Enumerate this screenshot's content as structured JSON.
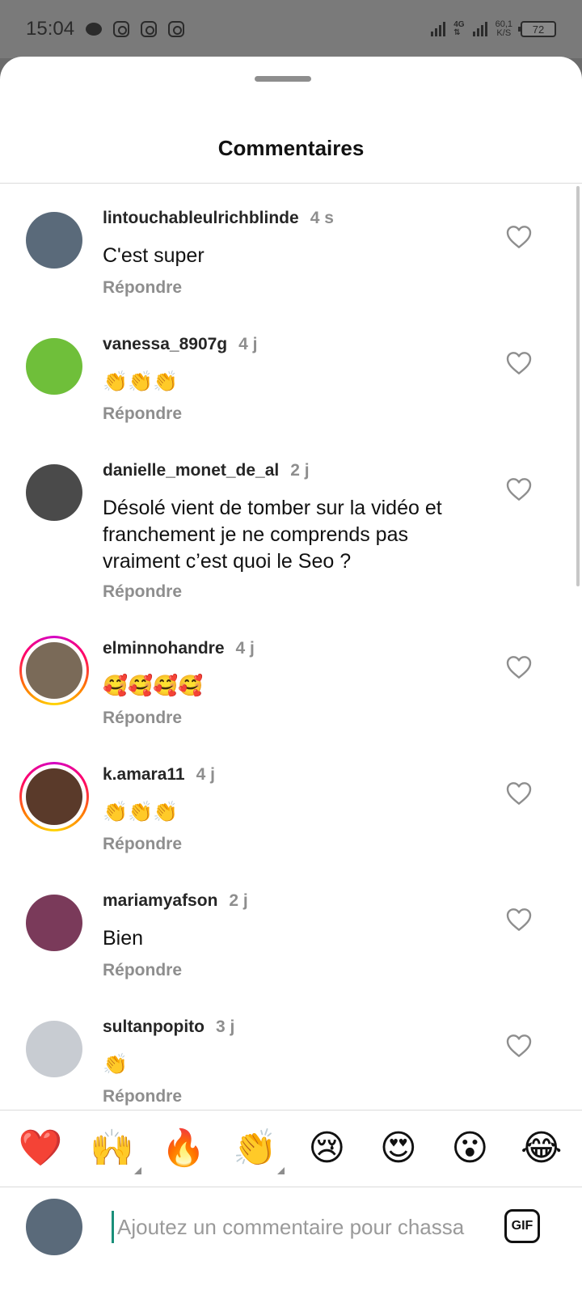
{
  "status_bar": {
    "time": "15:04",
    "network": "4G",
    "speed_value": "60,1",
    "speed_unit": "K/S",
    "battery": "72"
  },
  "sheet": {
    "title": "Commentaires"
  },
  "comments": [
    {
      "user": "lintouchableulrichblinde",
      "time": "4 s",
      "text": "C'est super",
      "reply": "Répondre",
      "avatar_color": "#5a6a7a",
      "story_ring": false
    },
    {
      "user": "vanessa_8907g",
      "time": "4 j",
      "text": "👏👏👏",
      "reply": "Répondre",
      "avatar_color": "#6fbf3a",
      "story_ring": false
    },
    {
      "user": "danielle_monet_de_al",
      "time": "2 j",
      "text": "Désolé vient de tomber sur la vidéo et franchement je ne comprends pas vraiment c’est quoi le Seo ?",
      "reply": "Répondre",
      "avatar_color": "#4a4a4a",
      "story_ring": false
    },
    {
      "user": "elminnohandre",
      "time": "4 j",
      "text": "🥰🥰🥰🥰",
      "reply": "Répondre",
      "avatar_color": "#7a6a58",
      "story_ring": true
    },
    {
      "user": "k.amara11",
      "time": "4 j",
      "text": "👏👏👏",
      "reply": "Répondre",
      "avatar_color": "#5a3a2a",
      "story_ring": true
    },
    {
      "user": "mariamyafson",
      "time": "2 j",
      "text": "Bien",
      "reply": "Répondre",
      "avatar_color": "#7a3a5a",
      "story_ring": false
    },
    {
      "user": "sultanpopito",
      "time": "3 j",
      "text": "👏",
      "reply": "Répondre",
      "avatar_color": "#c8ccd2",
      "story_ring": false
    }
  ],
  "emoji_bar": [
    "❤️",
    "🙌",
    "🔥",
    "👏",
    "😢",
    "😍",
    "😮",
    "😂"
  ],
  "composer": {
    "placeholder": "Ajoutez un commentaire pour chassa",
    "gif_label": "GIF",
    "avatar_color": "#5a6a7a"
  }
}
